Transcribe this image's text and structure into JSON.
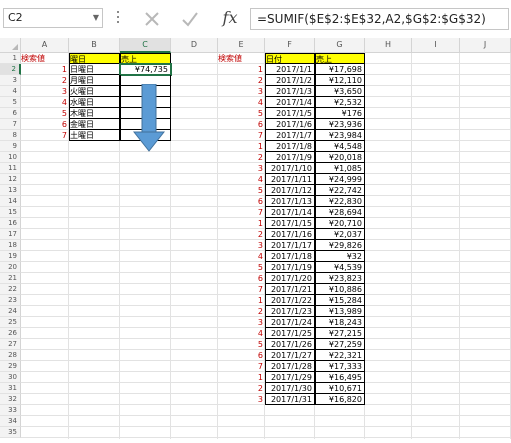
{
  "formula_bar": {
    "name_box": "C2",
    "formula": "=SUMIF($E$2:$E$32,A2,$G$2:$G$32)",
    "fx_label": "fx"
  },
  "columns": [
    "A",
    "B",
    "C",
    "D",
    "E",
    "F",
    "G",
    "H",
    "I",
    "J"
  ],
  "rows": [
    "1",
    "2",
    "3",
    "4",
    "5",
    "6",
    "7",
    "8",
    "9",
    "10",
    "11",
    "12",
    "13",
    "14",
    "15",
    "16",
    "17",
    "18",
    "19",
    "20",
    "21",
    "22",
    "23",
    "24",
    "25",
    "26",
    "27",
    "28",
    "29",
    "30",
    "31",
    "32",
    "33",
    "34",
    "35"
  ],
  "active_cell": {
    "column": "C",
    "row": "2"
  },
  "lookup_table": {
    "a1_label": "検索値",
    "b1_header": "曜日",
    "c1_header": "売上",
    "keys": [
      "1",
      "2",
      "3",
      "4",
      "5",
      "6",
      "7"
    ],
    "days": [
      "日曜日",
      "月曜日",
      "火曜日",
      "水曜日",
      "木曜日",
      "金曜日",
      "土曜日"
    ],
    "c2_value": "¥74,735"
  },
  "data_table": {
    "e1_label": "検索値",
    "f1_header": "日付",
    "g1_header": "売上",
    "keys": [
      "1",
      "2",
      "3",
      "4",
      "5",
      "6",
      "7",
      "1",
      "2",
      "3",
      "4",
      "5",
      "6",
      "7",
      "1",
      "2",
      "3",
      "4",
      "5",
      "6",
      "7",
      "1",
      "2",
      "3",
      "4",
      "5",
      "6",
      "7",
      "1",
      "2",
      "3"
    ],
    "dates": [
      "2017/1/1",
      "2017/1/2",
      "2017/1/3",
      "2017/1/4",
      "2017/1/5",
      "2017/1/6",
      "2017/1/7",
      "2017/1/8",
      "2017/1/9",
      "2017/1/10",
      "2017/1/11",
      "2017/1/12",
      "2017/1/13",
      "2017/1/14",
      "2017/1/15",
      "2017/1/16",
      "2017/1/17",
      "2017/1/18",
      "2017/1/19",
      "2017/1/20",
      "2017/1/21",
      "2017/1/22",
      "2017/1/23",
      "2017/1/24",
      "2017/1/25",
      "2017/1/26",
      "2017/1/27",
      "2017/1/28",
      "2017/1/29",
      "2017/1/30",
      "2017/1/31"
    ],
    "sales": [
      "¥17,698",
      "¥12,110",
      "¥3,650",
      "¥2,532",
      "¥176",
      "¥23,936",
      "¥23,984",
      "¥4,548",
      "¥20,018",
      "¥1,085",
      "¥24,999",
      "¥22,742",
      "¥22,830",
      "¥28,694",
      "¥20,710",
      "¥2,037",
      "¥29,826",
      "¥32",
      "¥4,539",
      "¥23,823",
      "¥10,886",
      "¥15,284",
      "¥13,989",
      "¥18,243",
      "¥27,215",
      "¥27,259",
      "¥22,321",
      "¥17,333",
      "¥16,495",
      "¥10,671",
      "¥16,820"
    ]
  },
  "colors": {
    "header_fill": "#ffff00",
    "red_text": "#c00000",
    "arrow": "#5b9bd5",
    "selection": "#217346"
  }
}
